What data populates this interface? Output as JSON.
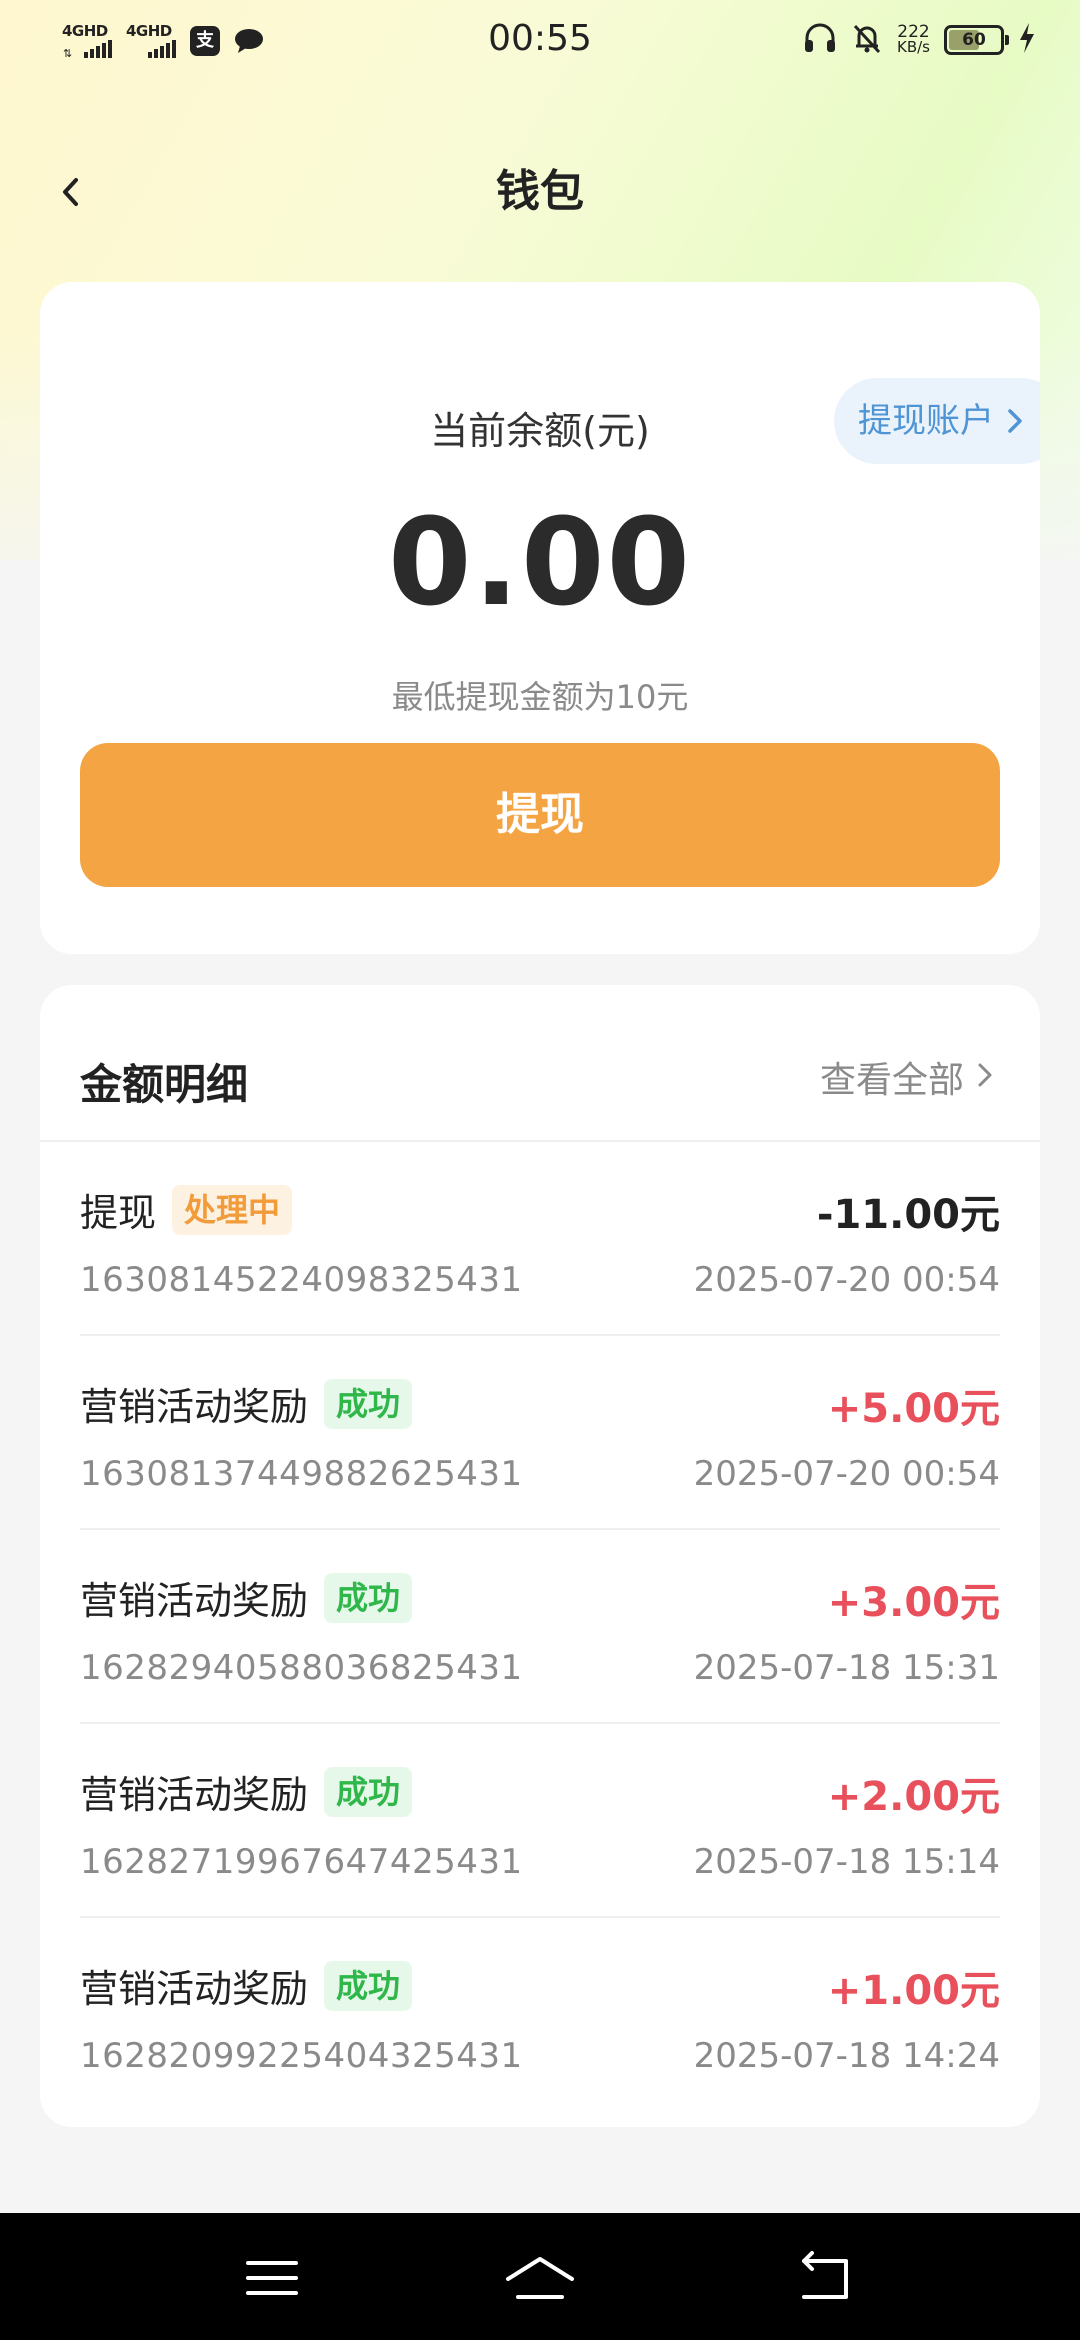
{
  "status_bar": {
    "time": "00:55",
    "signal1_label": "4GHD",
    "signal2_label": "4GHD",
    "app_icon_char": "支",
    "net_speed_value": "222",
    "net_speed_unit": "KB/s",
    "battery_level": "60",
    "battery_fraction": 0.6
  },
  "header": {
    "title": "钱包"
  },
  "balance": {
    "label": "当前余额(元)",
    "amount": "0.00",
    "min_tip": "最低提现金额为10元",
    "account_button": "提现账户",
    "withdraw_button": "提现"
  },
  "details": {
    "title": "金额明细",
    "view_all": "查看全部",
    "records": [
      {
        "name": "提现",
        "status": "处理中",
        "status_type": "pending",
        "id": "1630814522409832543​1",
        "amount": "-11.00元",
        "sign": "neg",
        "date": "2025-07-20 00:54"
      },
      {
        "name": "营销活动奖励",
        "status": "成功",
        "status_type": "ok",
        "id": "1630813744988262543​1",
        "amount": "+5.00元",
        "sign": "pos",
        "date": "2025-07-20 00:54"
      },
      {
        "name": "营销活动奖励",
        "status": "成功",
        "status_type": "ok",
        "id": "1628294058803682543​1",
        "amount": "+3.00元",
        "sign": "pos",
        "date": "2025-07-18 15:31"
      },
      {
        "name": "营销活动奖励",
        "status": "成功",
        "status_type": "ok",
        "id": "1628271996764742543​1",
        "amount": "+2.00元",
        "sign": "pos",
        "date": "2025-07-18 15:14"
      },
      {
        "name": "营销活动奖励",
        "status": "成功",
        "status_type": "ok",
        "id": "1628209922540432543​1",
        "amount": "+1.00元",
        "sign": "pos",
        "date": "2025-07-18 14:24"
      }
    ]
  },
  "colors": {
    "accent_orange": "#f5a444",
    "link_blue": "#4f94d4",
    "positive_red": "#e8505b",
    "success_green": "#2fb74a",
    "pending_orange": "#f29b3a"
  },
  "icons": {
    "back": "chevron-left-icon",
    "account_chevron": "chevron-right-icon",
    "view_all_chevron": "chevron-right-icon",
    "nav_menu": "menu-icon",
    "nav_home": "home-icon",
    "nav_back": "return-icon"
  }
}
